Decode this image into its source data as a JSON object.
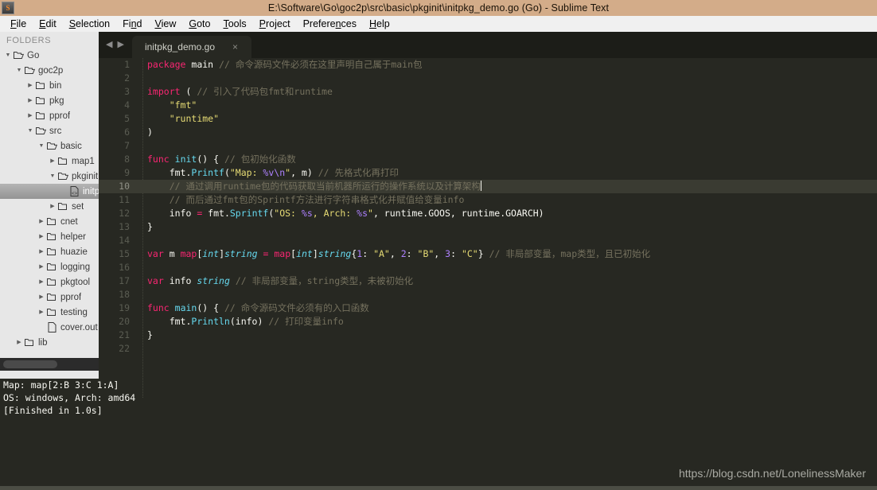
{
  "window": {
    "title": "E:\\Software\\Go\\goc2p\\src\\basic\\pkginit\\initpkg_demo.go (Go) - Sublime Text",
    "app_icon": "S"
  },
  "menubar": {
    "items": [
      {
        "label": "File",
        "accel": "F"
      },
      {
        "label": "Edit",
        "accel": "E"
      },
      {
        "label": "Selection",
        "accel": "S"
      },
      {
        "label": "Find",
        "accel": "n"
      },
      {
        "label": "View",
        "accel": "V"
      },
      {
        "label": "Goto",
        "accel": "G"
      },
      {
        "label": "Tools",
        "accel": "T"
      },
      {
        "label": "Project",
        "accel": "P"
      },
      {
        "label": "Preferences",
        "accel": "n"
      },
      {
        "label": "Help",
        "accel": "H"
      }
    ]
  },
  "sidebar": {
    "header": "FOLDERS",
    "tree": [
      {
        "label": "Go",
        "depth": 0,
        "type": "folder-open",
        "state": "open",
        "selected": false
      },
      {
        "label": "goc2p",
        "depth": 1,
        "type": "folder-open",
        "state": "open",
        "selected": false
      },
      {
        "label": "bin",
        "depth": 2,
        "type": "folder-closed",
        "state": "closed",
        "selected": false
      },
      {
        "label": "pkg",
        "depth": 2,
        "type": "folder-closed",
        "state": "closed",
        "selected": false
      },
      {
        "label": "pprof",
        "depth": 2,
        "type": "folder-closed",
        "state": "closed",
        "selected": false
      },
      {
        "label": "src",
        "depth": 2,
        "type": "folder-open",
        "state": "open",
        "selected": false
      },
      {
        "label": "basic",
        "depth": 3,
        "type": "folder-open",
        "state": "open",
        "selected": false
      },
      {
        "label": "map1",
        "depth": 4,
        "type": "folder-closed",
        "state": "closed",
        "selected": false
      },
      {
        "label": "pkginit",
        "depth": 4,
        "type": "folder-open",
        "state": "open",
        "selected": false
      },
      {
        "label": "initpkg",
        "depth": 5,
        "type": "file-code",
        "state": "none",
        "selected": true
      },
      {
        "label": "set",
        "depth": 4,
        "type": "folder-closed",
        "state": "closed",
        "selected": false
      },
      {
        "label": "cnet",
        "depth": 3,
        "type": "folder-closed",
        "state": "closed",
        "selected": false
      },
      {
        "label": "helper",
        "depth": 3,
        "type": "folder-closed",
        "state": "closed",
        "selected": false
      },
      {
        "label": "huazie",
        "depth": 3,
        "type": "folder-closed",
        "state": "closed",
        "selected": false
      },
      {
        "label": "logging",
        "depth": 3,
        "type": "folder-closed",
        "state": "closed",
        "selected": false
      },
      {
        "label": "pkgtool",
        "depth": 3,
        "type": "folder-closed",
        "state": "closed",
        "selected": false
      },
      {
        "label": "pprof",
        "depth": 3,
        "type": "folder-closed",
        "state": "closed",
        "selected": false
      },
      {
        "label": "testing",
        "depth": 3,
        "type": "folder-closed",
        "state": "closed",
        "selected": false
      },
      {
        "label": "cover.out",
        "depth": 3,
        "type": "file-plain",
        "state": "none",
        "selected": false
      },
      {
        "label": "lib",
        "depth": 1,
        "type": "folder-closed",
        "state": "closed",
        "selected": false
      }
    ]
  },
  "tabbar": {
    "prev_icon": "◀",
    "next_icon": "▶",
    "tabs": [
      {
        "title": "initpkg_demo.go",
        "close": "×",
        "active": true
      }
    ]
  },
  "editor": {
    "active_line": 10,
    "line_numbers": [
      1,
      2,
      3,
      4,
      5,
      6,
      7,
      8,
      9,
      10,
      11,
      12,
      13,
      14,
      15,
      16,
      17,
      18,
      19,
      20,
      21,
      22
    ],
    "lines": [
      {
        "n": 1,
        "tokens": [
          {
            "t": "package",
            "c": "kw"
          },
          {
            "t": " ",
            "c": "plain"
          },
          {
            "t": "main",
            "c": "plain"
          },
          {
            "t": " ",
            "c": "plain"
          },
          {
            "t": "// 命令源码文件必须在这里声明自己属于main包",
            "c": "cmt"
          }
        ]
      },
      {
        "n": 2,
        "tokens": []
      },
      {
        "n": 3,
        "tokens": [
          {
            "t": "import",
            "c": "kw"
          },
          {
            "t": " ",
            "c": "plain"
          },
          {
            "t": "(",
            "c": "plain"
          },
          {
            "t": " ",
            "c": "plain"
          },
          {
            "t": "// 引入了代码包fmt和runtime",
            "c": "cmt"
          }
        ]
      },
      {
        "n": 4,
        "tokens": [
          {
            "t": "    ",
            "c": "plain"
          },
          {
            "t": "\"fmt\"",
            "c": "str"
          }
        ]
      },
      {
        "n": 5,
        "tokens": [
          {
            "t": "    ",
            "c": "plain"
          },
          {
            "t": "\"runtime\"",
            "c": "str"
          }
        ]
      },
      {
        "n": 6,
        "tokens": [
          {
            "t": ")",
            "c": "plain"
          }
        ]
      },
      {
        "n": 7,
        "tokens": []
      },
      {
        "n": 8,
        "tokens": [
          {
            "t": "func",
            "c": "kw"
          },
          {
            "t": " ",
            "c": "plain"
          },
          {
            "t": "init",
            "c": "fn"
          },
          {
            "t": "() { ",
            "c": "plain"
          },
          {
            "t": "// 包初始化函数",
            "c": "cmt"
          }
        ]
      },
      {
        "n": 9,
        "tokens": [
          {
            "t": "    fmt.",
            "c": "plain"
          },
          {
            "t": "Printf",
            "c": "fn"
          },
          {
            "t": "(",
            "c": "plain"
          },
          {
            "t": "\"Map: ",
            "c": "str"
          },
          {
            "t": "%v",
            "c": "esc"
          },
          {
            "t": "\\n",
            "c": "esc"
          },
          {
            "t": "\"",
            "c": "str"
          },
          {
            "t": ", m) ",
            "c": "plain"
          },
          {
            "t": "// 先格式化再打印",
            "c": "cmt"
          }
        ]
      },
      {
        "n": 10,
        "tokens": [
          {
            "t": "    ",
            "c": "plain"
          },
          {
            "t": "// 通过调用runtime包的代码获取当前机器所运行的操作系统以及计算架构",
            "c": "cmt"
          }
        ]
      },
      {
        "n": 11,
        "tokens": [
          {
            "t": "    ",
            "c": "plain"
          },
          {
            "t": "// 而后通过fmt包的Sprintf方法进行字符串格式化并赋值给变量info",
            "c": "cmt"
          }
        ]
      },
      {
        "n": 12,
        "tokens": [
          {
            "t": "    info ",
            "c": "plain"
          },
          {
            "t": "=",
            "c": "op"
          },
          {
            "t": " fmt.",
            "c": "plain"
          },
          {
            "t": "Sprintf",
            "c": "fn"
          },
          {
            "t": "(",
            "c": "plain"
          },
          {
            "t": "\"OS: ",
            "c": "str"
          },
          {
            "t": "%s",
            "c": "esc"
          },
          {
            "t": ", Arch: ",
            "c": "str"
          },
          {
            "t": "%s",
            "c": "esc"
          },
          {
            "t": "\"",
            "c": "str"
          },
          {
            "t": ", runtime.GOOS, runtime.GOARCH)",
            "c": "plain"
          }
        ]
      },
      {
        "n": 13,
        "tokens": [
          {
            "t": "}",
            "c": "plain"
          }
        ]
      },
      {
        "n": 14,
        "tokens": []
      },
      {
        "n": 15,
        "tokens": [
          {
            "t": "var",
            "c": "kw"
          },
          {
            "t": " m ",
            "c": "plain"
          },
          {
            "t": "map",
            "c": "kw"
          },
          {
            "t": "[",
            "c": "plain"
          },
          {
            "t": "int",
            "c": "typ"
          },
          {
            "t": "]",
            "c": "plain"
          },
          {
            "t": "string",
            "c": "typ"
          },
          {
            "t": " ",
            "c": "plain"
          },
          {
            "t": "=",
            "c": "op"
          },
          {
            "t": " ",
            "c": "plain"
          },
          {
            "t": "map",
            "c": "kw"
          },
          {
            "t": "[",
            "c": "plain"
          },
          {
            "t": "int",
            "c": "typ"
          },
          {
            "t": "]",
            "c": "plain"
          },
          {
            "t": "string",
            "c": "typ"
          },
          {
            "t": "{",
            "c": "plain"
          },
          {
            "t": "1",
            "c": "num"
          },
          {
            "t": ": ",
            "c": "plain"
          },
          {
            "t": "\"A\"",
            "c": "str"
          },
          {
            "t": ", ",
            "c": "plain"
          },
          {
            "t": "2",
            "c": "num"
          },
          {
            "t": ": ",
            "c": "plain"
          },
          {
            "t": "\"B\"",
            "c": "str"
          },
          {
            "t": ", ",
            "c": "plain"
          },
          {
            "t": "3",
            "c": "num"
          },
          {
            "t": ": ",
            "c": "plain"
          },
          {
            "t": "\"C\"",
            "c": "str"
          },
          {
            "t": "} ",
            "c": "plain"
          },
          {
            "t": "// 非局部变量，map类型，且已初始化",
            "c": "cmt"
          }
        ]
      },
      {
        "n": 16,
        "tokens": []
      },
      {
        "n": 17,
        "tokens": [
          {
            "t": "var",
            "c": "kw"
          },
          {
            "t": " info ",
            "c": "plain"
          },
          {
            "t": "string",
            "c": "typ"
          },
          {
            "t": " ",
            "c": "plain"
          },
          {
            "t": "// 非局部变量，string类型，未被初始化",
            "c": "cmt"
          }
        ]
      },
      {
        "n": 18,
        "tokens": []
      },
      {
        "n": 19,
        "tokens": [
          {
            "t": "func",
            "c": "kw"
          },
          {
            "t": " ",
            "c": "plain"
          },
          {
            "t": "main",
            "c": "fn"
          },
          {
            "t": "() { ",
            "c": "plain"
          },
          {
            "t": "// 命令源码文件必须有的入口函数",
            "c": "cmt"
          }
        ]
      },
      {
        "n": 20,
        "tokens": [
          {
            "t": "    fmt.",
            "c": "plain"
          },
          {
            "t": "Println",
            "c": "fn"
          },
          {
            "t": "(info) ",
            "c": "plain"
          },
          {
            "t": "// 打印变量info",
            "c": "cmt"
          }
        ]
      },
      {
        "n": 21,
        "tokens": [
          {
            "t": "}",
            "c": "plain"
          }
        ]
      },
      {
        "n": 22,
        "tokens": []
      }
    ]
  },
  "console": {
    "lines": [
      "Map: map[2:B 3:C 1:A]",
      "OS: windows, Arch: amd64",
      "[Finished in 1.0s]"
    ]
  },
  "watermark": {
    "text": "https://blog.csdn.net/LonelinessMaker"
  },
  "colors": {
    "titlebar": "#d3ac89",
    "editor_bg": "#272822",
    "sidebar_bg": "#e7e7e7",
    "keyword": "#f92672",
    "function": "#66d9ef",
    "string": "#e6db74",
    "comment": "#75715e",
    "number": "#ae81ff"
  }
}
